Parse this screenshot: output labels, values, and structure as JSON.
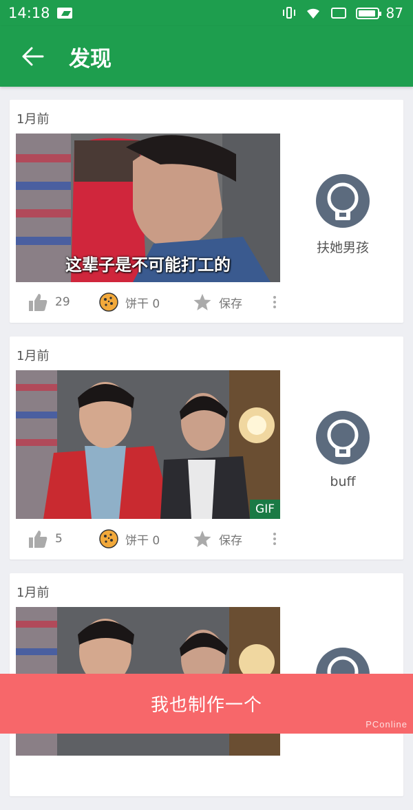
{
  "status_bar": {
    "time": "14:18",
    "battery": "87"
  },
  "app_bar": {
    "title": "发现"
  },
  "posts": [
    {
      "time": "1月前",
      "subtitle": "这辈子是不可能打工的",
      "is_gif": false,
      "likes": "29",
      "cookie": "饼干 0",
      "save": "保存",
      "author": "扶她男孩"
    },
    {
      "time": "1月前",
      "subtitle": "",
      "is_gif": true,
      "gif_label": "GIF",
      "likes": "5",
      "cookie": "饼干 0",
      "save": "保存",
      "author": "buff"
    },
    {
      "time": "1月前"
    }
  ],
  "make_button": "我也制作一个",
  "watermark": "PConline",
  "colors": {
    "brand_green": "#1e9e4e",
    "make_button": "#f7676a",
    "gif_badge": "#1a7a45"
  },
  "icons": [
    "back-arrow-icon",
    "thumb-up-icon",
    "cookie-icon",
    "star-icon",
    "more-vertical-icon",
    "avatar-icon"
  ]
}
